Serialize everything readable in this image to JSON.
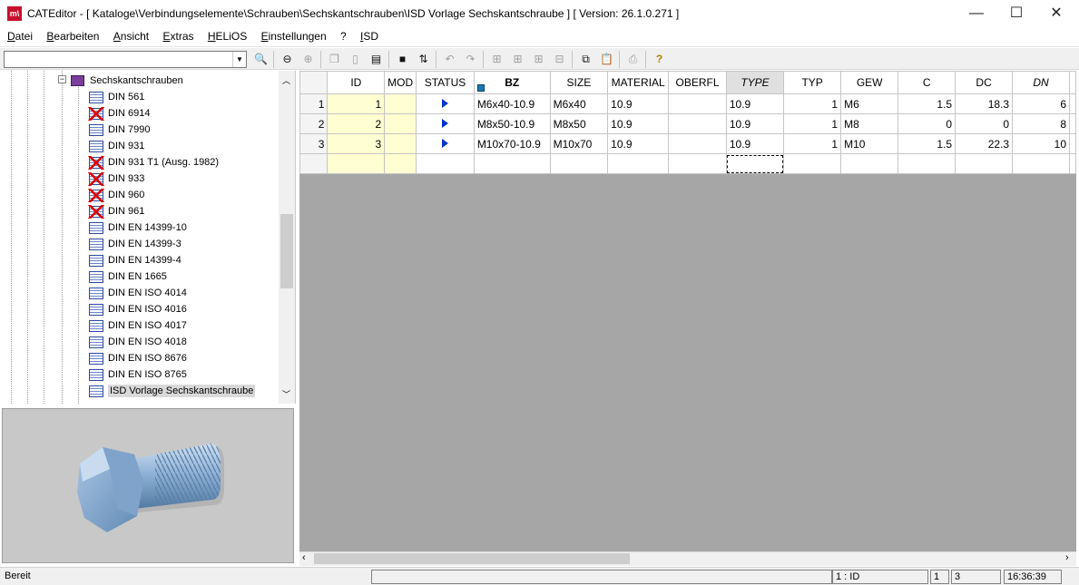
{
  "window": {
    "app_icon": "m\\",
    "title": "CATEditor - [ Kataloge\\Verbindungselemente\\Schrauben\\Sechskantschrauben\\ISD Vorlage Sechskantschraube ]    [ Version: 26.1.0.271 ]",
    "minimize": "—",
    "maximize": "☐",
    "close": "✕"
  },
  "menu": [
    "Datei",
    "Bearbeiten",
    "Ansicht",
    "Extras",
    "HELiOS",
    "Einstellungen",
    "?",
    "ISD"
  ],
  "toolbar": {
    "combo_value": "",
    "icons": [
      "binoculars-icon",
      "back-icon",
      "forward-icon",
      "copy-doc-icon",
      "new-doc-icon",
      "new-table-icon",
      "save-icon",
      "sort-icon",
      "undo-icon",
      "redo-icon",
      "add-row-icon",
      "insert-row-icon",
      "add-col-icon",
      "delete-col-icon",
      "copy-icon",
      "paste-icon",
      "print-icon",
      "help-icon"
    ]
  },
  "tree": {
    "parent": "Sechskantschrauben",
    "items": [
      {
        "label": "DIN 561",
        "deleted": false
      },
      {
        "label": "DIN 6914",
        "deleted": true
      },
      {
        "label": "DIN 7990",
        "deleted": false
      },
      {
        "label": "DIN 931",
        "deleted": false
      },
      {
        "label": "DIN 931 T1 (Ausg. 1982)",
        "deleted": true
      },
      {
        "label": "DIN 933",
        "deleted": true
      },
      {
        "label": "DIN 960",
        "deleted": true
      },
      {
        "label": "DIN 961",
        "deleted": true
      },
      {
        "label": "DIN EN 14399-10",
        "deleted": false
      },
      {
        "label": "DIN EN 14399-3",
        "deleted": false
      },
      {
        "label": "DIN EN 14399-4",
        "deleted": false
      },
      {
        "label": "DIN EN 1665",
        "deleted": false
      },
      {
        "label": "DIN EN ISO 4014",
        "deleted": false
      },
      {
        "label": "DIN EN ISO 4016",
        "deleted": false
      },
      {
        "label": "DIN EN ISO 4017",
        "deleted": false
      },
      {
        "label": "DIN EN ISO 4018",
        "deleted": false
      },
      {
        "label": "DIN EN ISO 8676",
        "deleted": false
      },
      {
        "label": "DIN EN ISO 8765",
        "deleted": false
      },
      {
        "label": "ISD Vorlage Sechskantschraube",
        "deleted": false,
        "selected": true
      }
    ]
  },
  "grid": {
    "columns": [
      "ID",
      "MOD",
      "STATUS",
      "BZ",
      "SIZE",
      "MATERIAL",
      "OBERFL",
      "TYPE",
      "TYP",
      "GEW",
      "C",
      "DC",
      "DN"
    ],
    "rows": [
      {
        "n": "1",
        "ID": "1",
        "MOD": "",
        "BZ": "M6x40-10.9",
        "SIZE": "M6x40",
        "MATERIAL": "10.9",
        "OBERFL": "",
        "TYPE": "10.9",
        "TYP": "1",
        "GEW": "M6",
        "C": "1.5",
        "DC": "18.3",
        "DN": "6"
      },
      {
        "n": "2",
        "ID": "2",
        "MOD": "",
        "BZ": "M8x50-10.9",
        "SIZE": "M8x50",
        "MATERIAL": "10.9",
        "OBERFL": "",
        "TYPE": "10.9",
        "TYP": "1",
        "GEW": "M8",
        "C": "0",
        "DC": "0",
        "DN": "8"
      },
      {
        "n": "3",
        "ID": "3",
        "MOD": "",
        "BZ": "M10x70-10.9",
        "SIZE": "M10x70",
        "MATERIAL": "10.9",
        "OBERFL": "",
        "TYPE": "10.9",
        "TYP": "1",
        "GEW": "M10",
        "C": "1.5",
        "DC": "22.3",
        "DN": "10"
      }
    ]
  },
  "status": {
    "text": "Bereit",
    "cell": "1 : ID",
    "field2": "1",
    "field3": "3",
    "time": "16:36:39"
  },
  "colors": {
    "selected_col_header": "#e0e0e0",
    "id_column": "#ffffd2",
    "status_arrow": "#0033cc",
    "grid_bg": "#a6a6a6"
  }
}
